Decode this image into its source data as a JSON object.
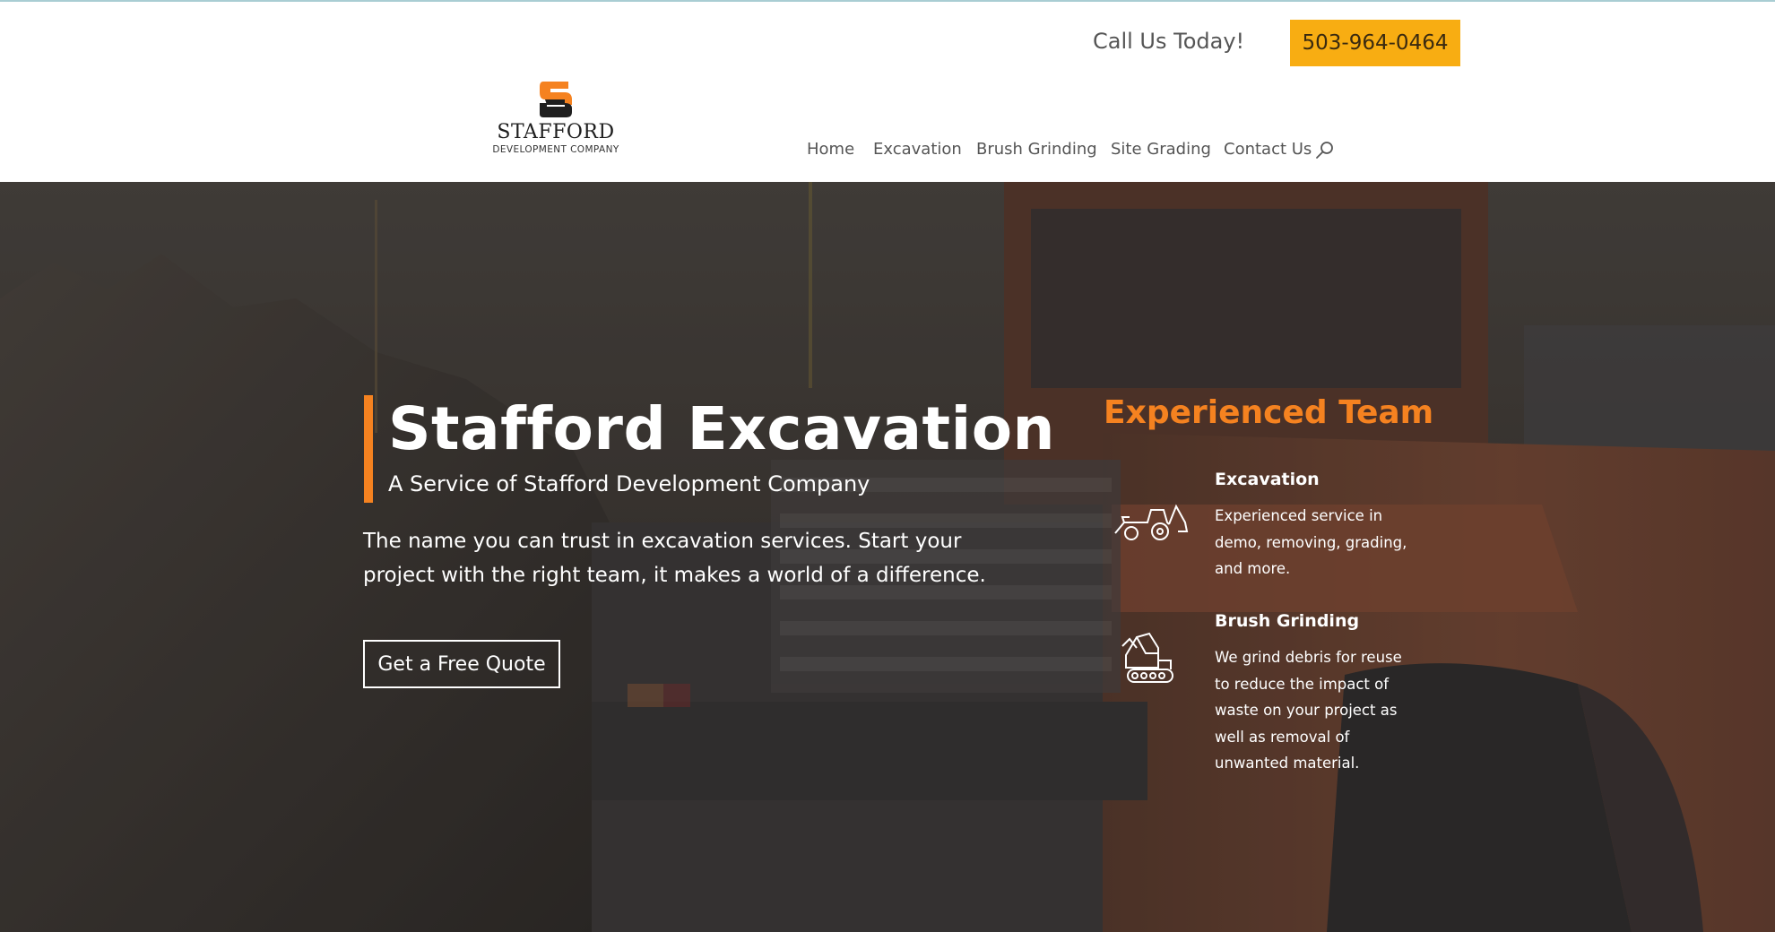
{
  "header": {
    "call_text": "Call Us Today!",
    "phone": "503-964-0464",
    "logo": {
      "name": "STAFFORD",
      "subtitle": "DEVELOPMENT COMPANY"
    },
    "nav": [
      {
        "label": "Home"
      },
      {
        "label": "Excavation"
      },
      {
        "label": "Brush Grinding"
      },
      {
        "label": "Site Grading"
      },
      {
        "label": "Contact Us"
      }
    ],
    "search_icon": "search-icon"
  },
  "hero": {
    "title": "Stafford Excavation",
    "subtitle": "A Service of Stafford Development Company",
    "description": "The name you can trust in excavation services.  Start your project with the right team, it makes a world of a difference.",
    "cta": "Get a Free Quote",
    "team_title": "Experienced Team",
    "services": [
      {
        "icon": "loader-tractor-icon",
        "heading": "Excavation",
        "text": "Experienced service in demo, removing, grading, and more."
      },
      {
        "icon": "excavator-icon",
        "heading": "Brush Grinding",
        "text": "We grind debris for reuse to reduce the impact of waste on your project as well as removal of unwanted material."
      }
    ]
  },
  "colors": {
    "accent_orange": "#f58220",
    "phone_button": "#f8ad12",
    "nav_text": "#555555"
  }
}
